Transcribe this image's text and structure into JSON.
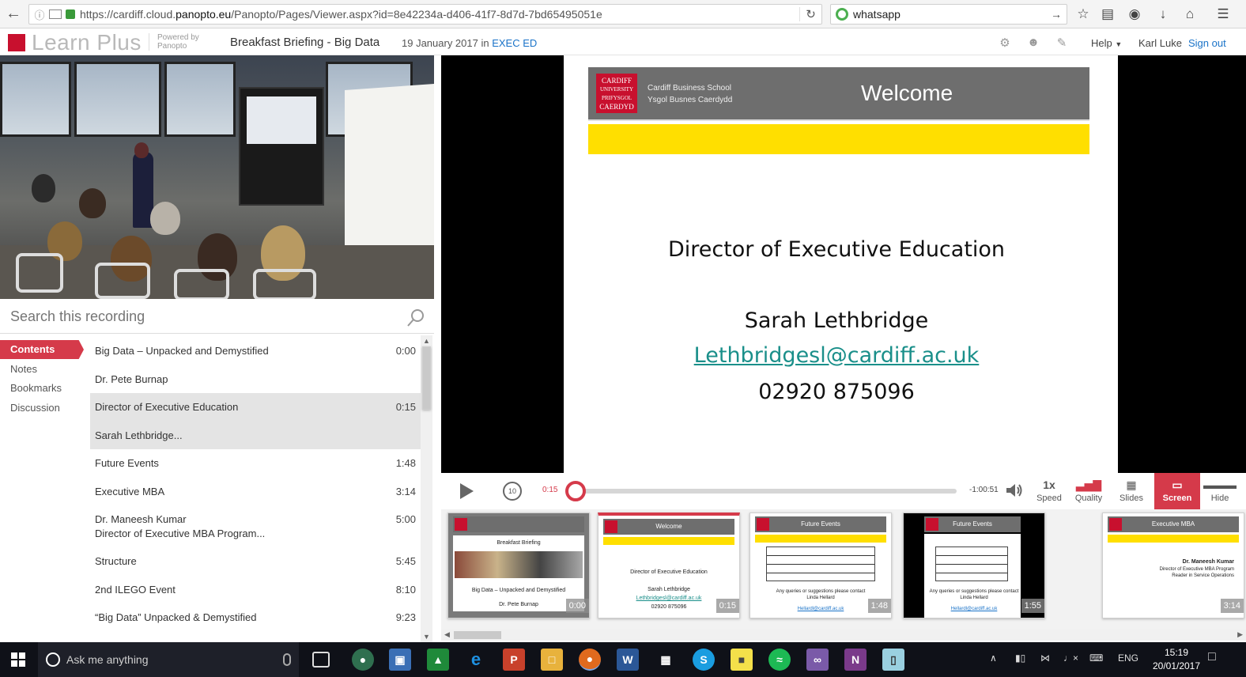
{
  "browser": {
    "url_prefix": "https://cardiff.cloud.",
    "url_domain": "panopto.eu",
    "url_suffix": "/Panopto/Pages/Viewer.aspx?id=8e42234a-d406-41f7-8d7d-7bd65495051e",
    "search_value": "whatsapp"
  },
  "header": {
    "logo_text": "Learn Plus",
    "powered_by_line1": "Powered by",
    "powered_by_line2": "Panopto",
    "session_title": "Breakfast Briefing - Big Data",
    "session_date": "19 January 2017 in",
    "folder_link": "EXEC ED",
    "help_label": "Help",
    "user_name": "Karl Luke",
    "sign_out": "Sign out"
  },
  "search": {
    "placeholder": "Search this recording"
  },
  "tabs": [
    {
      "label": "Contents",
      "active": true
    },
    {
      "label": "Notes"
    },
    {
      "label": "Bookmarks"
    },
    {
      "label": "Discussion"
    }
  ],
  "contents": [
    {
      "title": "Big Data – Unpacked and Demystified",
      "subtitle": "",
      "time": "0:00",
      "highlighted": false
    },
    {
      "title": "Dr. Pete Burnap",
      "subtitle": "",
      "time": "",
      "highlighted": false
    },
    {
      "title": "Director of Executive Education",
      "subtitle": "",
      "time": "0:15",
      "highlighted": true
    },
    {
      "title": "Sarah Lethbridge...",
      "subtitle": "",
      "time": "",
      "highlighted": true
    },
    {
      "title": "Future Events",
      "subtitle": "",
      "time": "1:48",
      "highlighted": false
    },
    {
      "title": "Executive MBA",
      "subtitle": "",
      "time": "3:14",
      "highlighted": false
    },
    {
      "title": "Dr. Maneesh Kumar",
      "subtitle": "Director of Executive MBA Program...",
      "time": "5:00",
      "highlighted": false
    },
    {
      "title": "Structure",
      "subtitle": "",
      "time": "5:45",
      "highlighted": false
    },
    {
      "title": "2nd ILEGO Event",
      "subtitle": "",
      "time": "8:10",
      "highlighted": false
    },
    {
      "title": "“Big Data” Unpacked & Demystified",
      "subtitle": "",
      "time": "9:23",
      "highlighted": false
    }
  ],
  "slide": {
    "crest_line1": "CARDIFF",
    "crest_line2": "UNIVERSITY",
    "crest_line3": "PRIFYSGOL",
    "crest_line4": "CAERDYD",
    "school_en": "Cardiff Business School",
    "school_cy": "Ysgol Busnes Caerdydd",
    "heading": "Welcome",
    "role": "Director of Executive Education",
    "name": "Sarah Lethbridge",
    "email": "Lethbridgesl@cardiff.ac.uk",
    "phone": "02920 875096",
    "colors": {
      "red": "#c8102e",
      "banner": "#6e6e6e",
      "yellow": "#ffdf00",
      "link": "#1a8f8a"
    }
  },
  "player": {
    "current_time": "0:15",
    "remaining_time": "-1:00:51",
    "progress": 0.004,
    "speed_value": "1x",
    "speed_label": "Speed",
    "quality_label": "Quality",
    "slides_label": "Slides",
    "screen_label": "Screen",
    "hide_label": "Hide",
    "accent": "#d53a4a"
  },
  "thumbnails": [
    {
      "title": "",
      "line1": "Breakfast Briefing",
      "line2": "Big Data – Unpacked and Demystified",
      "line3": "Dr. Pete Burnap",
      "line4": "",
      "time": "0:00",
      "variant": "photo"
    },
    {
      "title": "Welcome",
      "line1": "Director of Executive Education",
      "line2": "Sarah Lethbridge",
      "line3": "Lethbridgesl@cardiff.ac.uk",
      "line4": "02920 875096",
      "time": "0:15",
      "variant": "welcome"
    },
    {
      "title": "Future Events",
      "line1": "Any queries or suggestions please contact",
      "line2": "Linda Hellard",
      "line3": "Hellardl@cardiff.ac.uk",
      "line4": "",
      "time": "1:48",
      "variant": "grid"
    },
    {
      "title": "Future Events",
      "line1": "Any queries or suggestions please contact",
      "line2": "Linda Hellard",
      "line3": "Hellardl@cardiff.ac.uk",
      "line4": "",
      "time": "1:55",
      "variant": "grid-dark"
    },
    {
      "title": "Executive MBA",
      "line1": "Dr. Maneesh Kumar",
      "line2": "Director of Executive MBA Program",
      "line3": "Reader in Service Operations",
      "line4": "",
      "time": "3:14",
      "variant": "mba"
    }
  ],
  "taskbar": {
    "search_placeholder": "Ask me anything",
    "language": "ENG",
    "time": "15:19",
    "date": "20/01/2017"
  }
}
